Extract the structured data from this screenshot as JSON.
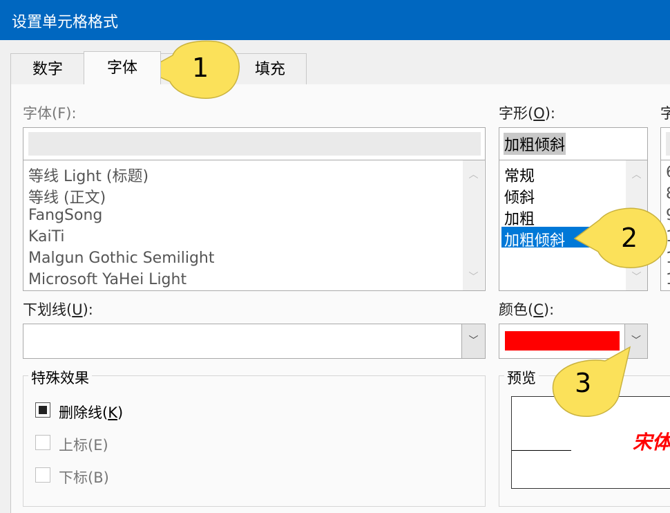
{
  "window": {
    "title": "设置单元格格式"
  },
  "tabs": [
    {
      "label": "数字"
    },
    {
      "label": "字体",
      "active": true
    },
    {
      "label": "填充"
    }
  ],
  "font": {
    "label": "字体(F):",
    "input_value": "",
    "list": [
      "等线 Light (标题)",
      "等线 (正文)",
      "FangSong",
      "KaiTi",
      "Malgun Gothic Semilight",
      "Microsoft YaHei Light"
    ]
  },
  "style": {
    "label_pre": "字形(",
    "label_key": "O",
    "label_post": "):",
    "input_value": "加粗倾斜",
    "list": [
      "常规",
      "倾斜",
      "加粗",
      "加粗倾斜"
    ],
    "selected": "加粗倾斜"
  },
  "size": {
    "label": "字",
    "list": [
      "6",
      "8",
      "9",
      "1",
      "1",
      "1"
    ]
  },
  "underline": {
    "label_pre": "下划线(",
    "label_key": "U",
    "label_post": "):",
    "value": ""
  },
  "color": {
    "label_pre": "颜色(",
    "label_key": "C",
    "label_post": "):",
    "swatch": "#ff0000"
  },
  "effects": {
    "title": "特殊效果",
    "strikethrough_pre": "删除线(",
    "strikethrough_key": "K",
    "strikethrough_post": ")",
    "strikethrough_checked": true,
    "superscript": "上标(E)",
    "subscript": "下标(B)"
  },
  "preview": {
    "title": "预览",
    "sample": "宋体"
  },
  "callouts": [
    "1",
    "2",
    "3"
  ],
  "colors": {
    "titlebar": "#0067c0",
    "selection": "#0078d7",
    "callout": "#fbe15a",
    "preview_text": "#ff0000"
  }
}
